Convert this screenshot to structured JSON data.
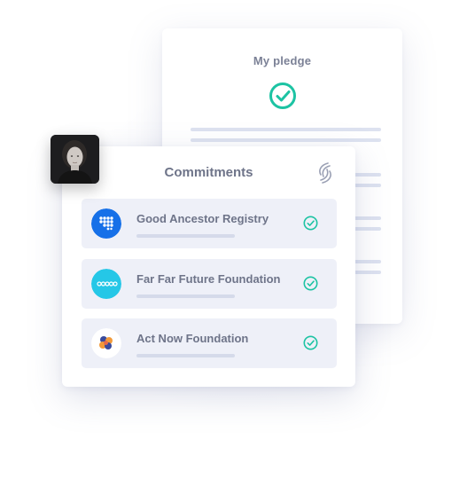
{
  "pledge": {
    "title": "My pledge"
  },
  "commitments": {
    "title": "Commitments",
    "items": [
      {
        "name": "Good Ancestor Registry",
        "logo": "good-ancestor-logo",
        "status": "confirmed"
      },
      {
        "name": "Far Far Future Foundation",
        "logo": "far-future-logo",
        "status": "confirmed"
      },
      {
        "name": "Act Now Foundation",
        "logo": "act-now-logo",
        "status": "confirmed"
      }
    ]
  },
  "colors": {
    "accent": "#1cc3a3",
    "text": "#6e7489",
    "item_bg": "#eef0f8",
    "good_ancestor": "#1670e8",
    "far_future": "#25c7e7"
  },
  "icons": {
    "check": "check-circle-icon",
    "brand": "brand-swirl-icon",
    "avatar": "user-avatar"
  }
}
